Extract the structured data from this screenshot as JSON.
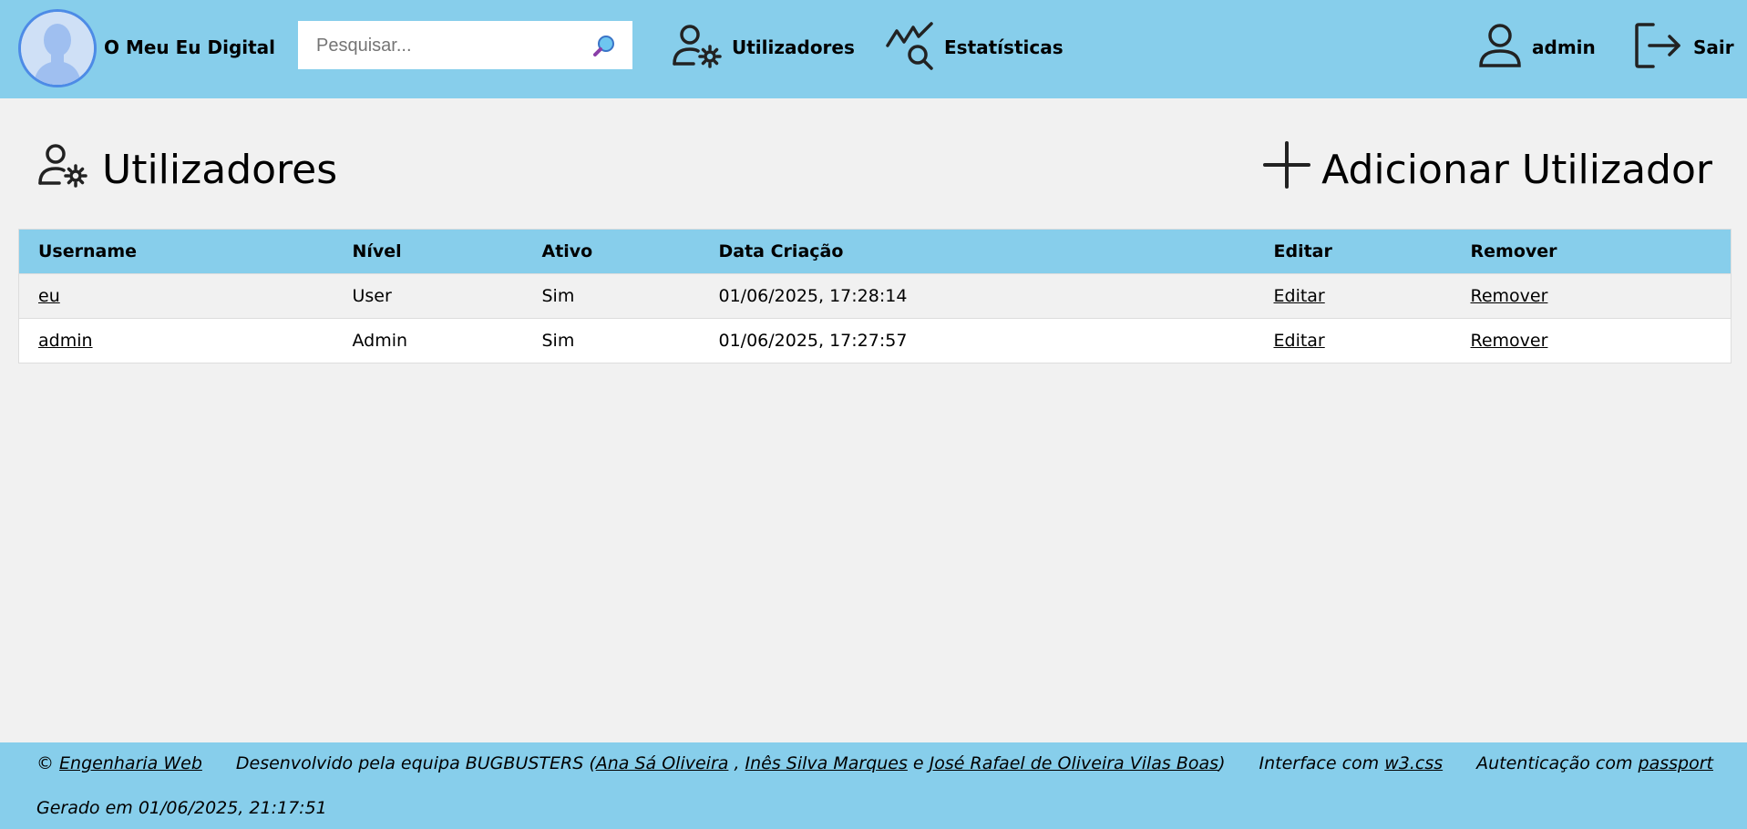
{
  "header": {
    "brand": "O Meu Eu Digital",
    "search_placeholder": "Pesquisar...",
    "nav": {
      "users": "Utilizadores",
      "stats": "Estatísticas",
      "account": "admin",
      "logout": "Sair"
    }
  },
  "page": {
    "title": "Utilizadores",
    "add_button": "Adicionar Utilizador"
  },
  "table": {
    "headers": [
      "Username",
      "Nível",
      "Ativo",
      "Data Criação",
      "Editar",
      "Remover"
    ],
    "rows": [
      {
        "username": "eu",
        "level": "User",
        "active": "Sim",
        "created": "01/06/2025, 17:28:14",
        "edit": "Editar",
        "remove": "Remover"
      },
      {
        "username": "admin",
        "level": "Admin",
        "active": "Sim",
        "created": "01/06/2025, 17:27:57",
        "edit": "Editar",
        "remove": "Remover"
      }
    ]
  },
  "footer": {
    "copyright_symbol": "©",
    "course_link": "Engenharia Web",
    "dev_prefix": "Desenvolvido pela equipa BUGBUSTERS (",
    "dev1": "Ana Sá Oliveira",
    "sep1": " , ",
    "dev2": "Inês Silva Marques",
    "sep2": " e ",
    "dev3": "José Rafael de Oliveira Vilas Boas",
    "dev_suffix": ")",
    "interface_prefix": "Interface com ",
    "interface_link": "w3.css",
    "auth_prefix": "Autenticação com ",
    "auth_link": "passport",
    "generated": "Gerado em 01/06/2025, 21:17:51"
  },
  "colors": {
    "accent": "#87ceeb",
    "background": "#f1f1f1",
    "avatar_border": "#4d8be6"
  },
  "icons": {
    "avatar": "user-avatar-icon",
    "search": "magnifier-icon",
    "users": "user-gear-icon",
    "stats": "chart-search-icon",
    "account": "user-icon",
    "logout": "logout-icon",
    "add": "plus-icon"
  }
}
